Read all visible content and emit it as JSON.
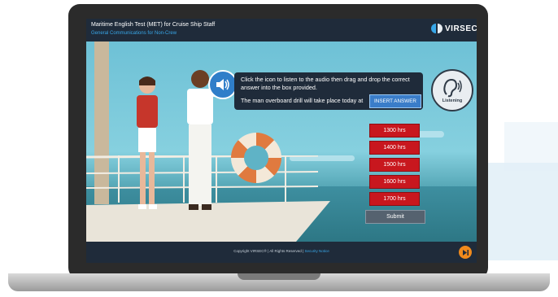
{
  "app": {
    "title": "Maritime English Test (MET) for Cruise Ship Staff",
    "subtitle": "General Communications for Non-Crew",
    "logo_text": "VIRSEC"
  },
  "instruction": {
    "text": "Click the icon to listen to the audio then drag and drop the correct answer into the box provided.",
    "sentence": "The man overboard drill will take place today at",
    "drop_box_label": "INSERT ANSWER"
  },
  "listening_badge": {
    "label": "Listening",
    "icon": "ear-icon"
  },
  "options": [
    "1300 hrs",
    "1400 hrs",
    "1500 hrs",
    "1600 hrs",
    "1700 hrs"
  ],
  "submit_label": "Submit",
  "footer": {
    "copyright": "Copyright VIRSEC® | All Rights Reserved |",
    "link": "Security Notice"
  },
  "colors": {
    "topbar": "#1f2b3a",
    "accent_blue": "#2f7ec9",
    "option_red": "#c8171e",
    "next_orange": "#f08a1c"
  }
}
